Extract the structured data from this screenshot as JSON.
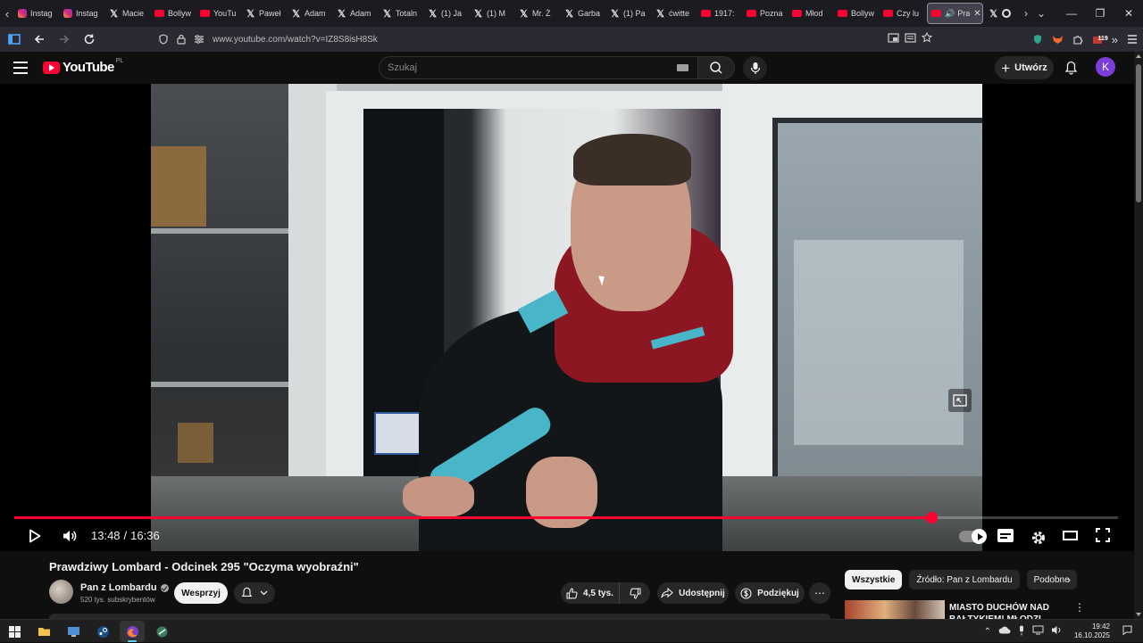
{
  "browser": {
    "tabs": [
      {
        "favicon": "instagram-icon",
        "title": "Instag"
      },
      {
        "favicon": "instagram-icon",
        "title": "Instag"
      },
      {
        "favicon": "x-icon",
        "title": "Macie"
      },
      {
        "favicon": "youtube-icon",
        "title": "Bollyw"
      },
      {
        "favicon": "youtube-icon",
        "title": "YouTu"
      },
      {
        "favicon": "x-icon",
        "title": "Paweł"
      },
      {
        "favicon": "x-icon",
        "title": "Adam"
      },
      {
        "favicon": "x-icon",
        "title": "Adam"
      },
      {
        "favicon": "x-icon",
        "title": "Totaln"
      },
      {
        "favicon": "x-icon",
        "title": "(1) Ja"
      },
      {
        "favicon": "x-icon",
        "title": "(1) M"
      },
      {
        "favicon": "x-icon",
        "title": "Mr. Ż"
      },
      {
        "favicon": "x-icon",
        "title": "Garba"
      },
      {
        "favicon": "x-icon",
        "title": "(1) Pa"
      },
      {
        "favicon": "x-icon",
        "title": "ćwitte"
      },
      {
        "favicon": "youtube-icon",
        "title": "1917:"
      },
      {
        "favicon": "youtube-icon",
        "title": "Pozna"
      },
      {
        "favicon": "youtube-icon",
        "title": "Młod"
      },
      {
        "favicon": "youtube-icon",
        "title": "Bollyw"
      },
      {
        "favicon": "youtube-icon",
        "title": "Czy lu"
      }
    ],
    "active_tab": {
      "title": "Pra"
    },
    "url": "www.youtube.com/watch?v=IZ8S8isH8Sk",
    "extension_badge": "119"
  },
  "youtube": {
    "country": "PL",
    "logo_text": "YouTube",
    "search_placeholder": "Szukaj",
    "create_label": "Utwórz",
    "avatar_letter": "K"
  },
  "player": {
    "current_time": "13:48",
    "separator": "/",
    "duration": "16:36",
    "progress_fraction": 0.831,
    "quality_badge": "4K"
  },
  "video": {
    "title": "Prawdziwy Lombard - Odcinek 295 \"Oczyma wyobraźni\"",
    "channel": "Pan z Lombardu",
    "subscribers": "520 tys. subskrybentów",
    "support_label": "Wesprzyj",
    "likes": "4,5 tys.",
    "share_label": "Udostępnij",
    "thanks_label": "Podziękuj"
  },
  "sidebar": {
    "chips": [
      "Wszystkie",
      "Źródło: Pan z Lombardu",
      "Podobne"
    ],
    "recommended": [
      {
        "title": "MIASTO DUCHÓW NAD BAŁTYKIEM! MŁODZI STĄD"
      }
    ]
  },
  "taskbar": {
    "time": "19:42",
    "date": "16.10.2025"
  },
  "colors": {
    "accent_red": "#ff0033",
    "background": "#0f0f0f",
    "chip_bg": "#272727"
  }
}
